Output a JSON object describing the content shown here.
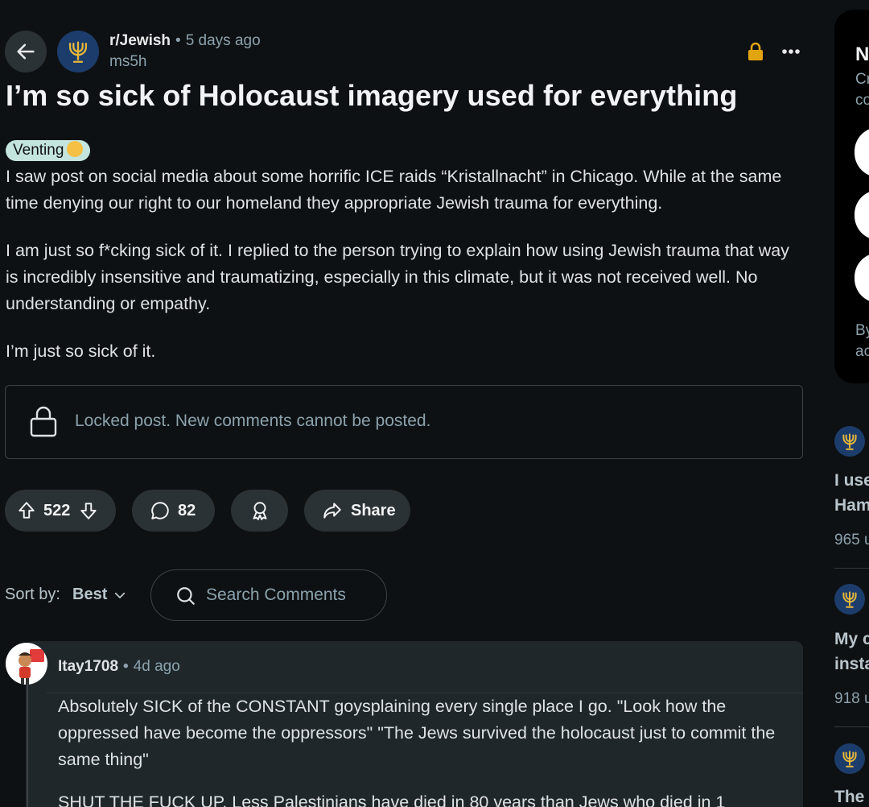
{
  "post": {
    "subreddit": "r/Jewish",
    "time": "5 days ago",
    "author": "ms5h",
    "title": "I’m so sick of Holocaust imagery used for everything",
    "flair": "Venting",
    "paragraphs": [
      "I saw post on social media about some horrific ICE raids “Kristallnacht” in Chicago. While at the same time denying our right to our homeland they appropriate Jewish trauma for everything.",
      "I am just so f*cking sick of it. I replied to the person trying to explain how using Jewish trauma that way is incredibly insensitive and traumatizing, especially in this climate, but it was not received well. No understanding or empathy.",
      "I’m just so sick of it."
    ],
    "locked_message": "Locked post. New comments cannot be posted."
  },
  "actions": {
    "votes": "522",
    "comments": "82",
    "share_label": "Share"
  },
  "sort": {
    "label": "Sort by:",
    "value": "Best"
  },
  "search": {
    "placeholder": "Search Comments"
  },
  "comment": {
    "username": "Itay1708",
    "time": "4d ago",
    "paragraphs": [
      "Absolutely SICK of the CONSTANT goysplaining every single place I go. \"Look how the oppressed have become the oppressors\" \"The Jews survived the holocaust just to commit the same thing\"",
      "SHUT THE FUCK UP. Less Palestinians have died in 80 years than Jews who died in 1"
    ]
  },
  "right_card": {
    "title": "N",
    "line1": "Cr",
    "line2": "co",
    "line3": "By",
    "line4": "ac"
  },
  "related": [
    {
      "title1": "I use",
      "title2": "Ham",
      "meta": "965 u"
    },
    {
      "title1": "My c",
      "title2": "insta",
      "meta": "918 u"
    },
    {
      "title1": "The"
    }
  ],
  "colors": {
    "background": "#0e1113",
    "button": "#2a3236",
    "flair": "#c4e5de",
    "lock": "#e3a411",
    "subreddit_avatar": "#1c3d6b",
    "menorah": "#e8b83a"
  },
  "icons": [
    "back-arrow-icon",
    "menorah-icon",
    "lock-icon",
    "more-icon",
    "upvote-icon",
    "downvote-icon",
    "comment-icon",
    "award-icon",
    "share-icon",
    "chevron-down-icon",
    "search-icon"
  ]
}
